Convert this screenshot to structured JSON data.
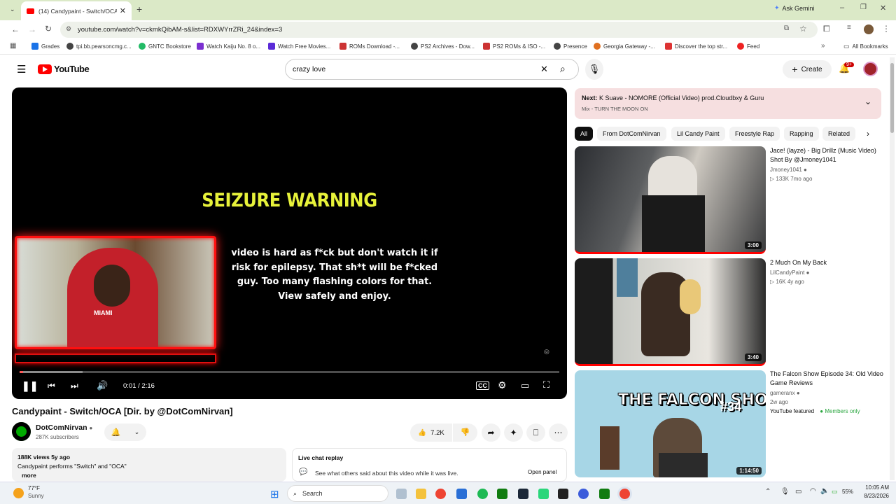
{
  "browser": {
    "tab_title": "(14) Candypaint - Switch/OCA [",
    "ask_gemini": "Ask Gemini",
    "url": "youtube.com/watch?v=ckmkQibAM-s&list=RDXWYrrZRi_24&index=3",
    "bookmarks": [
      "Grades",
      "tpi.bb.pearsoncmg.c...",
      "GNTC Bookstore",
      "Watch Kaiju No. 8 o...",
      "Watch Free Movies...",
      "ROMs Download -...",
      "PS2 Archives - Dow...",
      "PS2 ROMs & ISO -...",
      "Presence",
      "Georgia Gateway -...",
      "Discover the top str...",
      "Feed"
    ],
    "all_bookmarks": "All Bookmarks"
  },
  "yt": {
    "logo": "YouTube",
    "search_value": "crazy love",
    "create_label": "Create",
    "notif_badge": "9+"
  },
  "player": {
    "warning_title": "SEIZURE WARNING",
    "warning_lines": [
      "video is hard as f*ck but don't watch it if",
      "risk for epilepsy. That sh*t will be f*cked",
      "guy. Too many flashing colors for that.",
      "View safely and enjoy."
    ],
    "time": "0:01 / 2:16",
    "progress": 0.007
  },
  "video": {
    "title": "Candypaint - Switch/OCA [Dir. by @DotComNirvan]",
    "channel": "DotComNirvan",
    "subs": "287K subscribers",
    "likes": "7.2K",
    "views_line": "188K views  5y ago",
    "desc": "Candypaint performs \"Switch\" and \"OCA\"",
    "more": "more"
  },
  "chat": {
    "title": "Live chat replay",
    "desc": "See what others said about this video while it was live.",
    "open": "Open panel"
  },
  "upnext": {
    "next_label": "Next:",
    "next_title": "K Suave - NOMORE (Official Video) prod.Cloudbxy & Guru",
    "mix": "Mix - TURN THE MOON ON"
  },
  "chips": [
    "All",
    "From DotComNirvan",
    "Lil Candy Paint",
    "Freestyle Rap",
    "Rapping",
    "Related"
  ],
  "recs": [
    {
      "title": "Jace! (layze) - Big Drillz (Music Video) Shot By @Jmoney1041",
      "channel": "Jmoney1041",
      "meta": "133K  7mo ago",
      "dur": "3:00"
    },
    {
      "title": "2 Much On My Back",
      "channel": "LilCandyPaint",
      "meta": "16K  4y ago",
      "dur": "3:40"
    },
    {
      "title": "The Falcon Show Episode 34: Old Video Game Reviews",
      "channel": "gameranx",
      "meta": "2w ago",
      "dur": "1:14:50",
      "featured": "YouTube featured",
      "members": "Members only",
      "thumb_text": "THE FALCON SHOW",
      "thumb_num": "#34"
    }
  ],
  "taskbar": {
    "temp": "77°F",
    "weather": "Sunny",
    "search": "Search",
    "battery": "55%",
    "time": "10:05 AM",
    "date": "8/23/2026"
  }
}
